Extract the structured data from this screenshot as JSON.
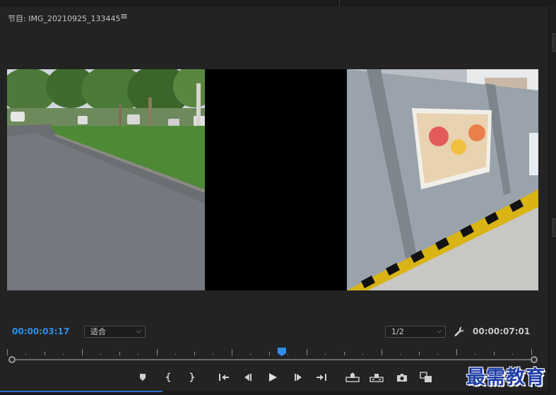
{
  "panel": {
    "title": "节目: IMG_20210925_133445",
    "menu_icon": "hamburger-menu-icon"
  },
  "timecode": {
    "current": "00:00:03:17",
    "duration": "00:00:07:01",
    "current_color": "#2f8fe8"
  },
  "zoom": {
    "selected": "适合"
  },
  "resolution": {
    "selected": "1/2"
  },
  "playhead": {
    "position_fraction": 0.52
  },
  "transport_buttons": [
    {
      "name": "add-marker-button",
      "icon": "marker-icon"
    },
    {
      "name": "mark-in-button",
      "icon": "mark-in-icon"
    },
    {
      "name": "mark-out-button",
      "icon": "mark-out-icon"
    },
    {
      "name": "go-to-in-button",
      "icon": "go-to-in-icon"
    },
    {
      "name": "step-back-button",
      "icon": "step-back-icon"
    },
    {
      "name": "play-button",
      "icon": "play-icon"
    },
    {
      "name": "step-forward-button",
      "icon": "step-forward-icon"
    },
    {
      "name": "go-to-out-button",
      "icon": "go-to-out-icon"
    },
    {
      "name": "lift-button",
      "icon": "lift-icon"
    },
    {
      "name": "extract-button",
      "icon": "extract-icon"
    },
    {
      "name": "export-frame-button",
      "icon": "camera-icon"
    },
    {
      "name": "compare-view-button",
      "icon": "compare-icon"
    }
  ],
  "watermark": {
    "text": "最需教育"
  },
  "colors": {
    "accent_blue": "#2f8fe8",
    "panel_bg": "#232323",
    "watermark": "#1f3ea8"
  }
}
